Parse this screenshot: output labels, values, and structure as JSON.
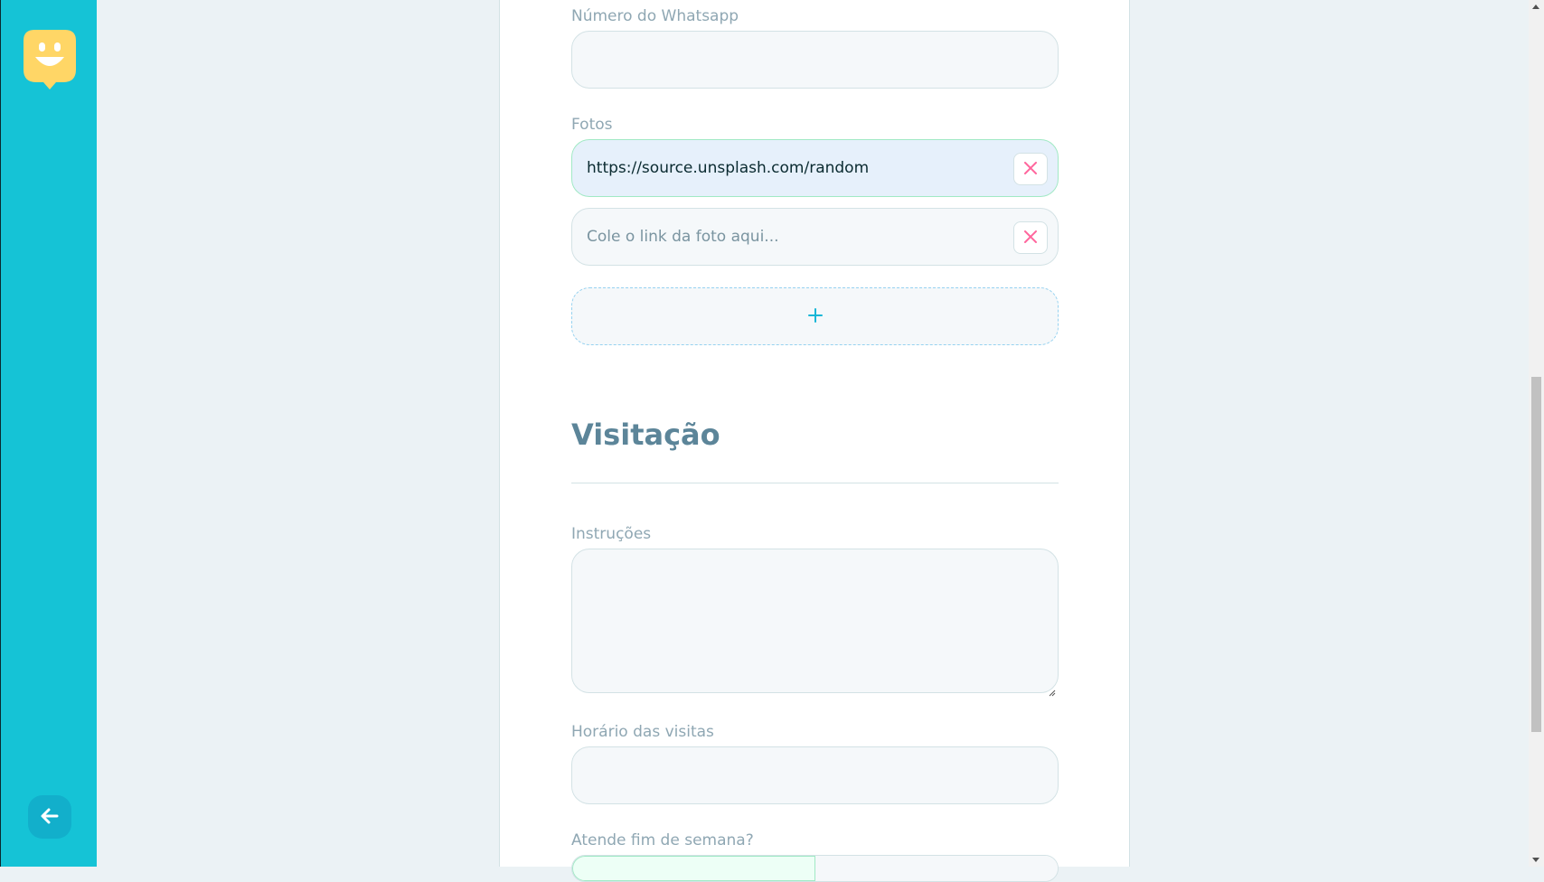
{
  "form": {
    "whatsapp_label": "Número do Whatsapp",
    "whatsapp_value": "",
    "photos_label": "Fotos",
    "photos": [
      {
        "value": "https://source.unsplash.com/random"
      },
      {
        "value": "",
        "placeholder": "Cole o link da foto aqui..."
      }
    ],
    "add_photo_icon": "plus-icon",
    "section_title": "Visitação",
    "instructions_label": "Instruções",
    "instructions_value": "",
    "hours_label": "Horário das visitas",
    "hours_value": "",
    "weekends_label": "Atende fim de semana?"
  },
  "sidebar": {
    "logo_icon": "happy-face-logo",
    "back_icon": "arrow-left-icon"
  },
  "colors": {
    "sidebar_bg": "#15c3d6",
    "logo": "#ffd666",
    "accent": "#15c3d6",
    "danger": "#ff669d",
    "title": "#5c8599"
  }
}
